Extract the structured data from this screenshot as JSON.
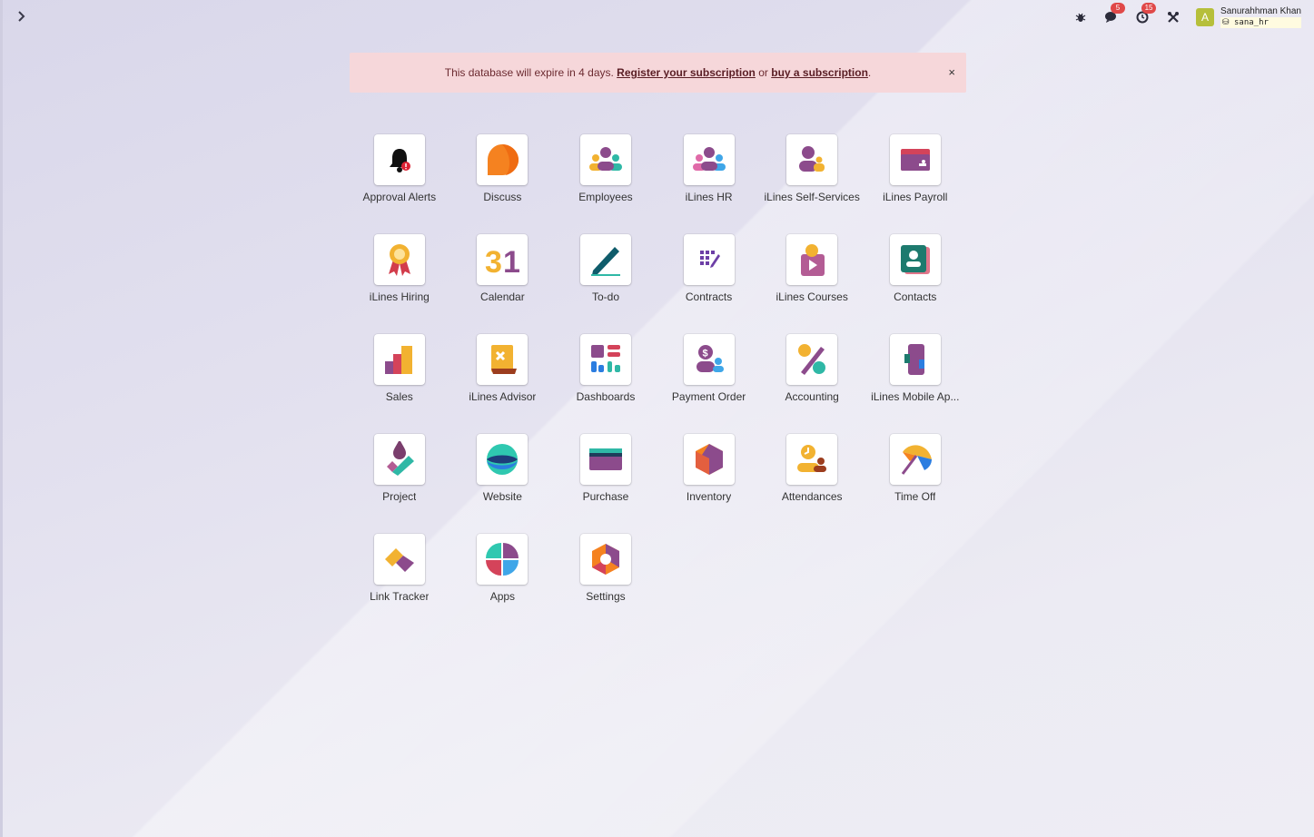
{
  "topbar": {
    "badges": {
      "messages": "5",
      "activities": "15"
    },
    "user": {
      "avatar_letter": "A",
      "name": "Sanurahhman Khan",
      "database": "sana_hr"
    }
  },
  "alert": {
    "text_before": "This database will expire in 4 days. ",
    "register_link": "Register your subscription",
    "middle": " or ",
    "buy_link": "buy a subscription",
    "end": ".",
    "close": "×"
  },
  "apps": [
    {
      "label": "Approval Alerts",
      "icon": "bell-icon"
    },
    {
      "label": "Discuss",
      "icon": "chat-bubble-icon"
    },
    {
      "label": "Employees",
      "icon": "people-icon"
    },
    {
      "label": "iLines HR",
      "icon": "people-icon"
    },
    {
      "label": "iLines Self-Services",
      "icon": "person-icon"
    },
    {
      "label": "iLines Payroll",
      "icon": "wallet-icon"
    },
    {
      "label": "iLines Hiring",
      "icon": "ribbon-icon"
    },
    {
      "label": "Calendar",
      "icon": "calendar-icon"
    },
    {
      "label": "To-do",
      "icon": "pen-icon"
    },
    {
      "label": "Contracts",
      "icon": "contract-icon"
    },
    {
      "label": "iLines Courses",
      "icon": "video-icon"
    },
    {
      "label": "Contacts",
      "icon": "contact-card-icon"
    },
    {
      "label": "Sales",
      "icon": "bar-chart-icon"
    },
    {
      "label": "iLines Advisor",
      "icon": "advisor-icon"
    },
    {
      "label": "Dashboards",
      "icon": "dashboard-icon"
    },
    {
      "label": "Payment Order",
      "icon": "payment-icon"
    },
    {
      "label": "Accounting",
      "icon": "percent-icon"
    },
    {
      "label": "iLines Mobile Ap...",
      "icon": "mobile-icon"
    },
    {
      "label": "Project",
      "icon": "project-icon"
    },
    {
      "label": "Website",
      "icon": "globe-icon"
    },
    {
      "label": "Purchase",
      "icon": "card-icon"
    },
    {
      "label": "Inventory",
      "icon": "box-icon"
    },
    {
      "label": "Attendances",
      "icon": "clock-person-icon"
    },
    {
      "label": "Time Off",
      "icon": "umbrella-icon"
    },
    {
      "label": "Link Tracker",
      "icon": "link-icon"
    },
    {
      "label": "Apps",
      "icon": "apps-icon"
    },
    {
      "label": "Settings",
      "icon": "gear-icon"
    }
  ]
}
